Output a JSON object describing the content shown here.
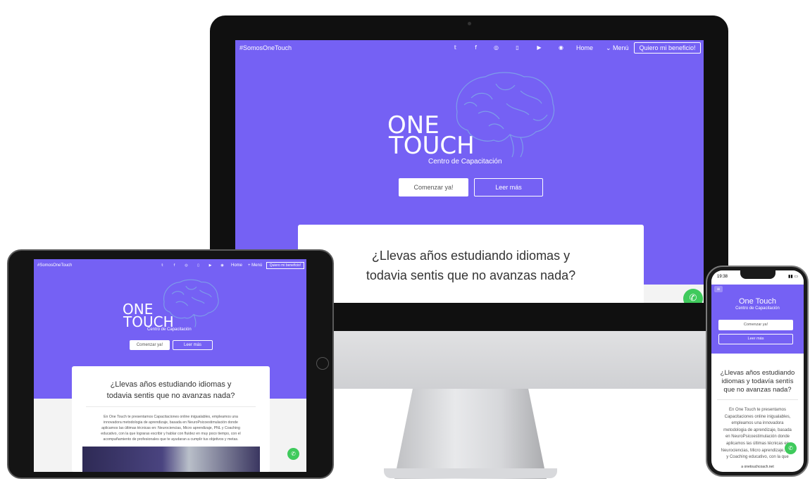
{
  "site": {
    "tagline": "#SomosOneTouch",
    "nav": {
      "social_icons": [
        {
          "name": "twitter-icon",
          "glyph": "𝕥"
        },
        {
          "name": "facebook-icon",
          "glyph": "f"
        },
        {
          "name": "instagram-icon",
          "glyph": "◎"
        },
        {
          "name": "twitch-icon",
          "glyph": "▯"
        },
        {
          "name": "youtube-icon",
          "glyph": "▶"
        },
        {
          "name": "spotify-icon",
          "glyph": "◉"
        }
      ],
      "home": "Home",
      "menu": "⌄ Menú",
      "menu_tablet": "+ Menú",
      "cta": "Quiero mi beneficio!"
    },
    "logo": {
      "line1": "ONE",
      "line2": "TOUCH",
      "subtitle": "Centro de Capacitación",
      "mobile_title": "One Touch"
    },
    "buttons": {
      "primary": "Comenzar ya!",
      "secondary": "Leer más"
    },
    "headline_line1": "¿Llevas años estudiando idiomas y",
    "headline_line2": "todavia sentis que no avanzas nada?",
    "mobile_headline": [
      "¿Llevas años estudiando",
      "idiomas y todavía sentís",
      "que no avanzas nada?"
    ],
    "intro_paragraph": [
      "En One Touch te presentamos Capacitaciones online inigualables, empleamos una",
      "innovadora metodologia de aprendizaje, basada en NeuroPsicoestimulación donde",
      "aplicamos las últimas técnicas en: Neurociencias, Micro aprendizaje, PNL y Coaching",
      "educativo, con la que lograras escribir y hablar con fluidez en muy poco tiempo, con el",
      "acompañamiento de profesionales que te ayudaran a cumplir tus objetivos y metas."
    ],
    "mobile_paragraph": [
      "En One Touch te presentamos",
      "Capacitaciones online inigualables,",
      "empleamos una innovadora",
      "metodologia de aprendizaje, basada",
      "en NeuroPsicoestimulación donde",
      "aplicamos las últimas técnicas en",
      "Neurociencias, Micro aprendizaje, PNL",
      "y Coaching educativo, con la que"
    ],
    "whatsapp_icon": "whatsapp-icon",
    "url": "a onetouchcoach.net",
    "phone_time": "19:38",
    "colors": {
      "brand": "#7561f4",
      "whatsapp": "#3fca5c",
      "card": "#ffffff"
    }
  }
}
